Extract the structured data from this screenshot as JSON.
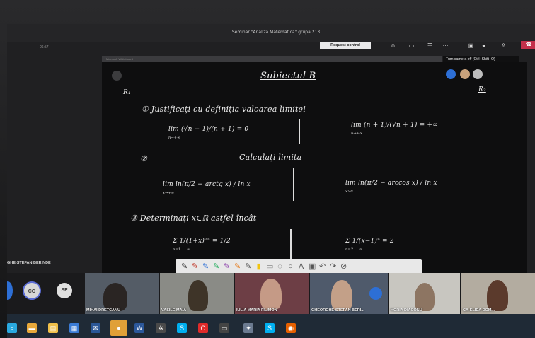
{
  "meeting": {
    "title": "Seminar \"Analiza Matematica\" grupa 213",
    "elapsed": "06:57",
    "request_control": "Request control",
    "tooltip": "Turn camera off (Ctrl+Shift+O)",
    "leave_icon": "phone-hangup-icon"
  },
  "toolbar_icons": [
    "people-icon",
    "chat-icon",
    "reactions-icon",
    "more-icon",
    "camera-icon",
    "mic-icon",
    "share-icon"
  ],
  "whiteboard": {
    "heading": "Subiectul B",
    "r1": "R₁",
    "r2": "R₂",
    "q1_prompt": "① Justificați cu definiția valoarea limitei",
    "q1_left": "lim (√n − 1)/(n + 1) = 0",
    "q1_left_sub": "n→+∞",
    "q1_right": "lim (n + 1)/(√n + 1) = +∞",
    "q1_right_sub": "n→+∞",
    "q2_prompt": "Calculați limita",
    "q2_num": "②",
    "q2_left": "lim ln(π/2 − arctg x) / ln x",
    "q2_left_sub": "x→+∞",
    "q2_right": "lim ln(π/2 − arccos x) / ln x",
    "q2_right_sub": "x↘0",
    "q3_prompt": "③ Determinați x∈ℝ astfel încât",
    "q3_left": "Σ 1/(1+x)²ⁿ = 1/2",
    "q3_left_lim": "n=1 … ∞",
    "q3_right": "Σ 1/(x−1)ⁿ = 2",
    "q3_right_lim": "n=2 … ∞"
  },
  "pen_tools": [
    "pen-icon",
    "pen-icon",
    "pen-icon",
    "pen-icon",
    "pen-icon",
    "pen-icon",
    "pen-icon",
    "highlighter-icon",
    "eraser-icon",
    "lasso-icon",
    "shapes-icon",
    "text-icon",
    "image-icon",
    "undo-icon",
    "redo-icon",
    "clear-icon"
  ],
  "participants": {
    "presenter_label": "GHE-STEFAN BERINDE",
    "avatars": [
      {
        "initials": "CG",
        "color": "#d7d7d7"
      },
      {
        "initials": "SF",
        "color": "#e0e0e0"
      }
    ],
    "tiles": [
      {
        "name": "MIHAI DRETCANU"
      },
      {
        "name": "VASILE MAIA"
      },
      {
        "name": "IULIA MARIA FILIMON"
      },
      {
        "name": "GHEORGHE-STEFAN BERI..."
      },
      {
        "name": "HORIA DIACONU"
      },
      {
        "name": "CA-ELIDA DOM..."
      }
    ]
  },
  "taskbar": {
    "apps": [
      "search-icon",
      "taskview-icon",
      "files-icon",
      "store-icon",
      "mail-icon",
      "security-icon",
      "spotify-icon",
      "word-icon",
      "settings-icon",
      "skype-icon",
      "opera-icon",
      "browser-icon",
      "photos-icon",
      "skype-icon",
      "firefox-icon"
    ]
  }
}
